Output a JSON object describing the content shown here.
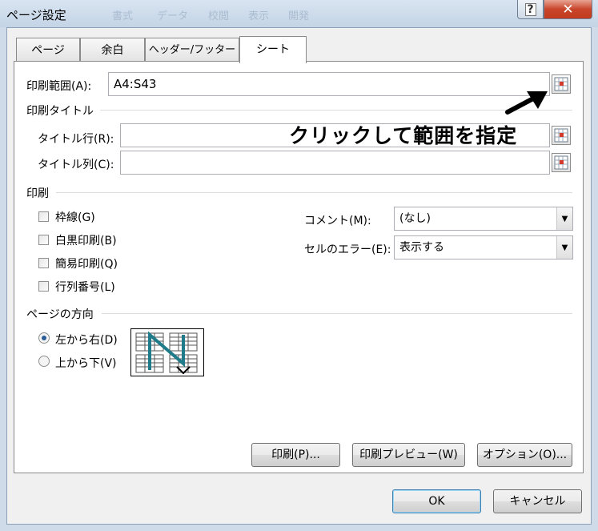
{
  "window": {
    "title": "ページ設定",
    "background_ribbon": [
      "書式",
      "データ",
      "校閲",
      "表示",
      "開発"
    ],
    "help_label": "?",
    "close_label": "✕"
  },
  "tabs": [
    {
      "label": "ページ",
      "active": false
    },
    {
      "label": "余白",
      "active": false
    },
    {
      "label": "ヘッダー/フッター",
      "active": false
    },
    {
      "label": "シート",
      "active": true
    }
  ],
  "print_area": {
    "label": "印刷範囲(A):",
    "value": "A4:S43"
  },
  "print_titles": {
    "group_label": "印刷タイトル",
    "rows_label": "タイトル行(R):",
    "rows_value": "",
    "cols_label": "タイトル列(C):",
    "cols_value": ""
  },
  "annotation": "クリックして範囲を指定",
  "print": {
    "group_label": "印刷",
    "checkboxes": [
      {
        "label": "枠線(G)",
        "checked": false
      },
      {
        "label": "白黒印刷(B)",
        "checked": false
      },
      {
        "label": "簡易印刷(Q)",
        "checked": false
      },
      {
        "label": "行列番号(L)",
        "checked": false
      }
    ],
    "comments_label": "コメント(M):",
    "comments_value": "(なし)",
    "errors_label": "セルのエラー(E):",
    "errors_value": "表示する"
  },
  "page_order": {
    "group_label": "ページの方向",
    "options": [
      {
        "label": "左から右(D)",
        "selected": true
      },
      {
        "label": "上から下(V)",
        "selected": false
      }
    ],
    "accent_color": "#1f7b8a"
  },
  "buttons": {
    "print": "印刷(P)...",
    "preview": "印刷プレビュー(W)",
    "options": "オプション(O)...",
    "ok": "OK",
    "cancel": "キャンセル"
  }
}
